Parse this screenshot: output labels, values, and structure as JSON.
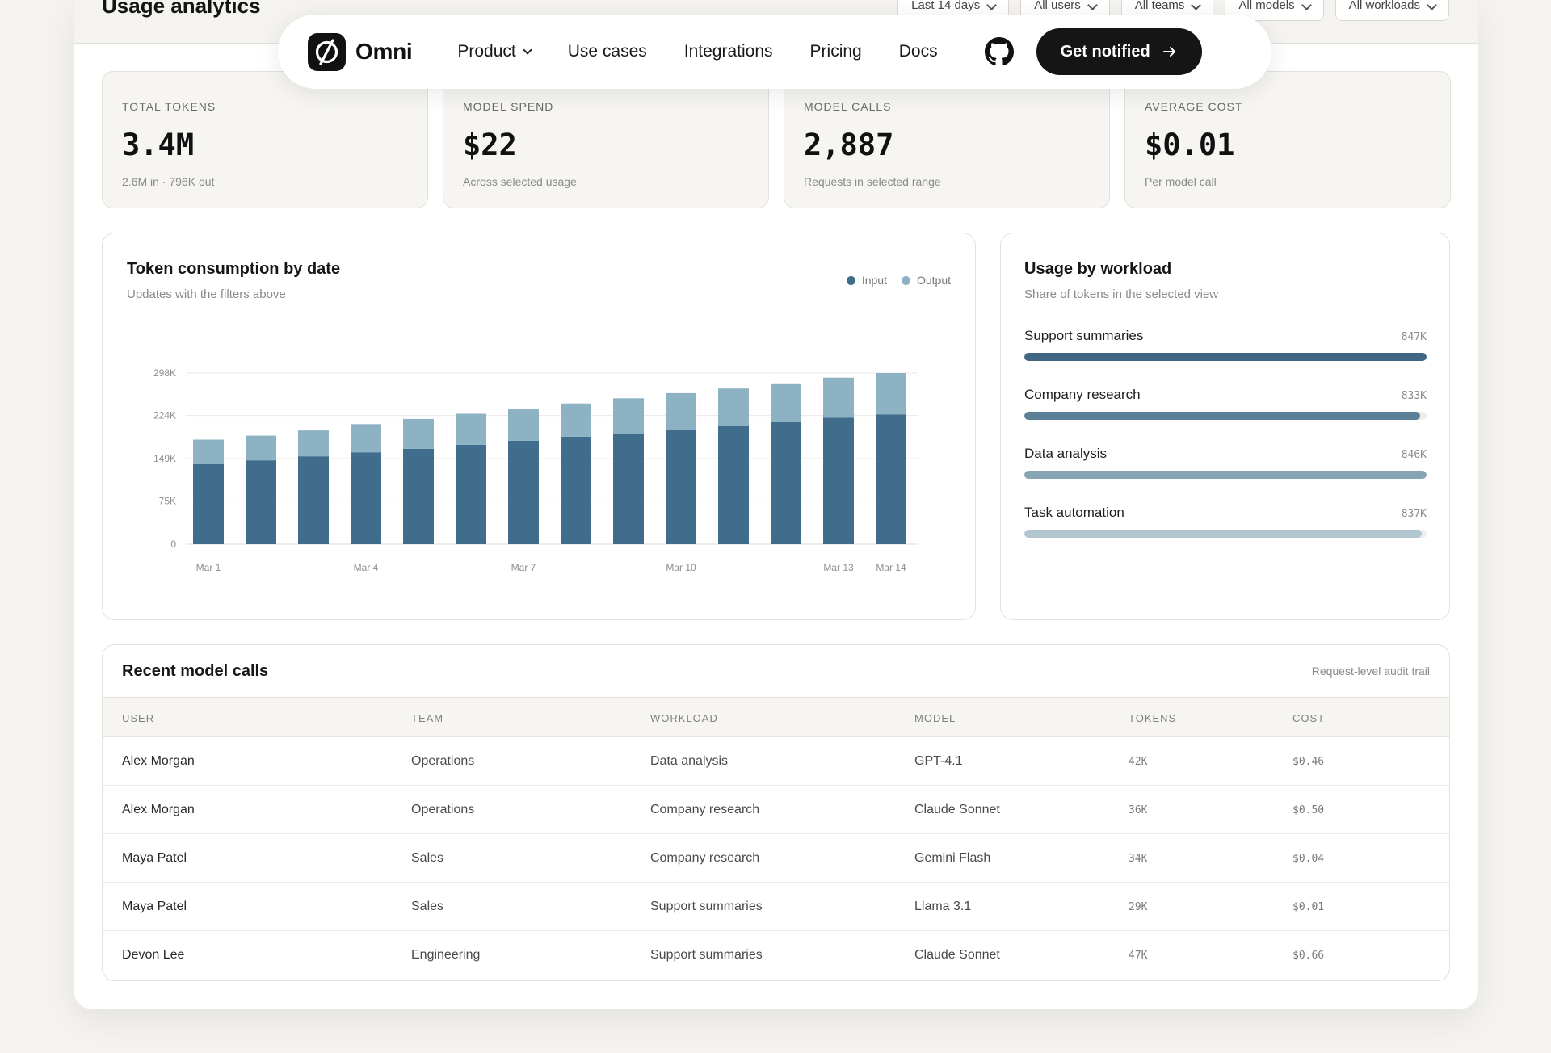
{
  "page": {
    "title": "Usage analytics"
  },
  "filters": [
    {
      "label": "Last 14 days"
    },
    {
      "label": "All users"
    },
    {
      "label": "All teams"
    },
    {
      "label": "All models"
    },
    {
      "label": "All workloads"
    }
  ],
  "nav": {
    "brand": "Omni",
    "links": [
      {
        "label": "Product",
        "dropdown": true
      },
      {
        "label": "Use cases"
      },
      {
        "label": "Integrations"
      },
      {
        "label": "Pricing"
      },
      {
        "label": "Docs"
      }
    ],
    "github_icon": "github-icon",
    "cta_label": "Get notified",
    "cta_icon": "arrow-right-icon"
  },
  "kpis": [
    {
      "label": "Total tokens",
      "value": "3.4M",
      "sub": "2.6M in · 796K out"
    },
    {
      "label": "Model spend",
      "value": "$22",
      "sub": "Across selected usage"
    },
    {
      "label": "Model calls",
      "value": "2,887",
      "sub": "Requests in selected range"
    },
    {
      "label": "Average cost",
      "value": "$0.01",
      "sub": "Per model call"
    }
  ],
  "token_chart": {
    "title": "Token consumption by date",
    "subtitle": "Updates with the filters above",
    "legend": [
      {
        "label": "Input",
        "color": "#406d8c"
      },
      {
        "label": "Output",
        "color": "#8db2c4"
      }
    ]
  },
  "chart_data": {
    "type": "bar",
    "stacked": true,
    "categories": [
      "Mar 1",
      "Mar 2",
      "Mar 3",
      "Mar 4",
      "Mar 5",
      "Mar 6",
      "Mar 7",
      "Mar 8",
      "Mar 9",
      "Mar 10",
      "Mar 11",
      "Mar 12",
      "Mar 13",
      "Mar 14"
    ],
    "x_tick_labels": [
      "Mar 1",
      "Mar 4",
      "Mar 7",
      "Mar 10",
      "Mar 13",
      "Mar 14"
    ],
    "y_tick_labels": [
      "0",
      "75K",
      "149K",
      "224K",
      "298K"
    ],
    "y_ticks": [
      0,
      75000,
      149000,
      224000,
      298000
    ],
    "ylim": [
      0,
      298000
    ],
    "series": [
      {
        "name": "Input",
        "color": "#406d8c",
        "values": [
          140000,
          146000,
          153000,
          160000,
          166000,
          173000,
          180000,
          187000,
          193000,
          200000,
          206000,
          213000,
          220000,
          226000
        ]
      },
      {
        "name": "Output",
        "color": "#8db2c4",
        "values": [
          42000,
          43000,
          45000,
          49000,
          52000,
          54000,
          56000,
          58000,
          61000,
          63000,
          65000,
          67000,
          70000,
          72000
        ]
      }
    ],
    "grid": true,
    "legend_position": "top-right"
  },
  "workloads": {
    "title": "Usage by workload",
    "subtitle": "Share of tokens in the selected view",
    "items": [
      {
        "name": "Support summaries",
        "value": "847K",
        "share": 1.0,
        "color": "#3f6784"
      },
      {
        "name": "Company research",
        "value": "833K",
        "share": 0.983,
        "color": "#5b7f97"
      },
      {
        "name": "Data analysis",
        "value": "846K",
        "share": 0.999,
        "color": "#86a5b5"
      },
      {
        "name": "Task automation",
        "value": "837K",
        "share": 0.988,
        "color": "#b2c6d0"
      }
    ]
  },
  "calls_table": {
    "title": "Recent model calls",
    "note": "Request-level audit trail",
    "columns": [
      "User",
      "Team",
      "Workload",
      "Model",
      "Tokens",
      "Cost"
    ],
    "rows": [
      {
        "user": "Alex Morgan",
        "team": "Operations",
        "workload": "Data analysis",
        "model": "GPT-4.1",
        "tokens": "42K",
        "cost": "$0.46"
      },
      {
        "user": "Alex Morgan",
        "team": "Operations",
        "workload": "Company research",
        "model": "Claude Sonnet",
        "tokens": "36K",
        "cost": "$0.50"
      },
      {
        "user": "Maya Patel",
        "team": "Sales",
        "workload": "Company research",
        "model": "Gemini Flash",
        "tokens": "34K",
        "cost": "$0.04"
      },
      {
        "user": "Maya Patel",
        "team": "Sales",
        "workload": "Support summaries",
        "model": "Llama 3.1",
        "tokens": "29K",
        "cost": "$0.01"
      },
      {
        "user": "Devon Lee",
        "team": "Engineering",
        "workload": "Support summaries",
        "model": "Claude Sonnet",
        "tokens": "47K",
        "cost": "$0.66"
      }
    ]
  }
}
